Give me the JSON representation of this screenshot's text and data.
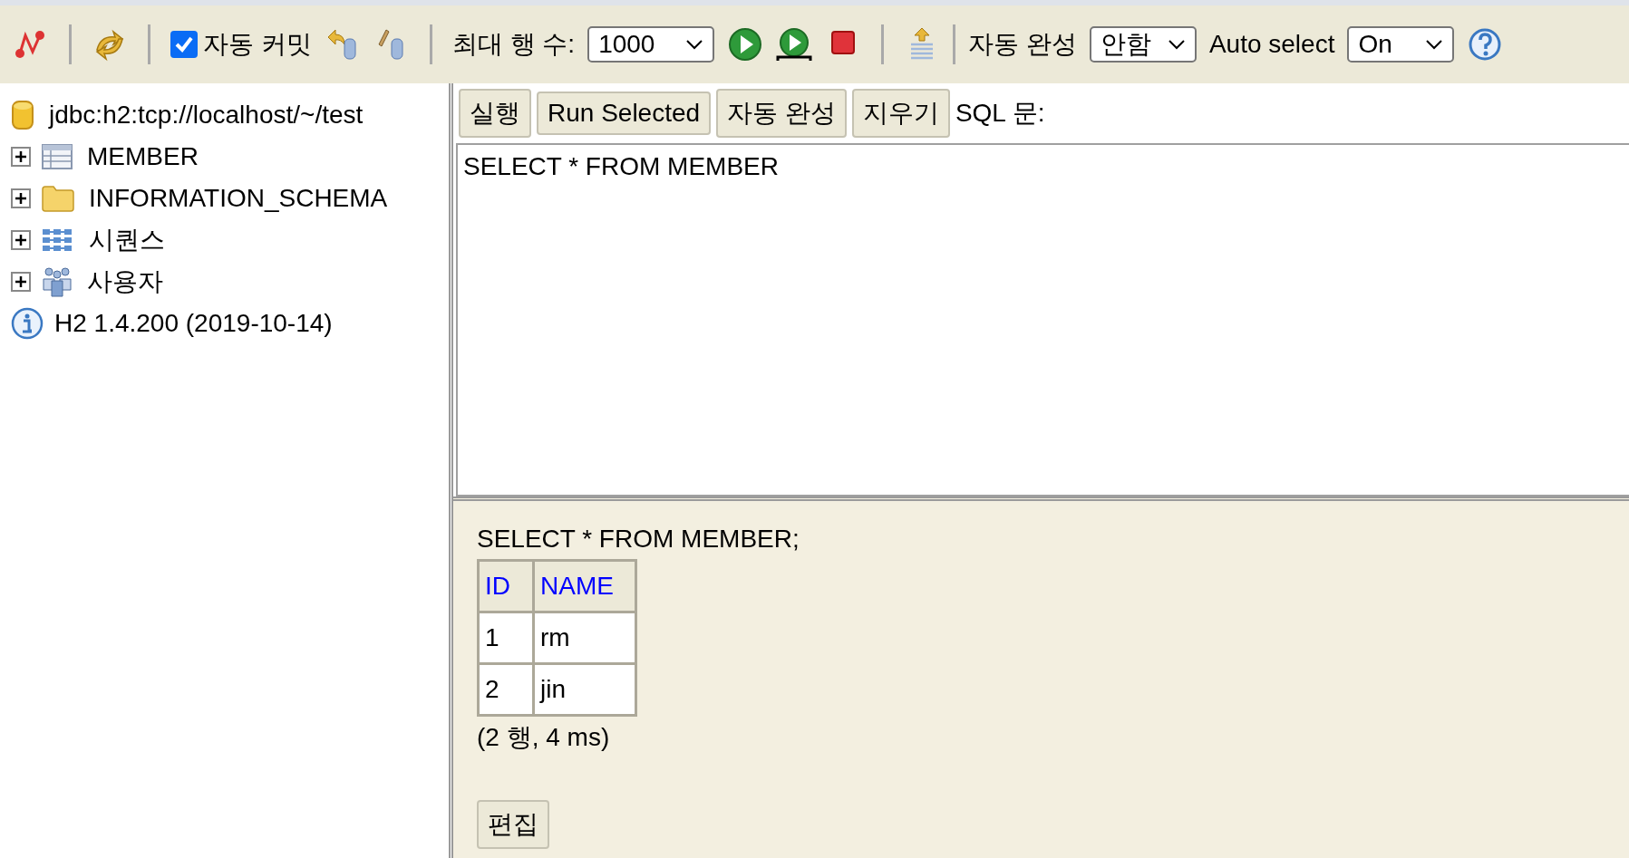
{
  "toolbar": {
    "autocommit": {
      "label": "자동 커밋",
      "checked": true
    },
    "max_rows": {
      "label": "최대 행 수:",
      "value": "1000"
    },
    "autocomplete": {
      "label": "자동 완성",
      "value": "안함"
    },
    "auto_select": {
      "label": "Auto select",
      "value": "On"
    }
  },
  "tree": {
    "connection": "jdbc:h2:tcp://localhost/~/test",
    "items": [
      {
        "label": "MEMBER",
        "kind": "table",
        "expanded": false
      },
      {
        "label": "INFORMATION_SCHEMA",
        "kind": "folder",
        "expanded": false
      },
      {
        "label": "시퀀스",
        "kind": "sequence",
        "expanded": false
      },
      {
        "label": "사용자",
        "kind": "users",
        "expanded": false
      }
    ],
    "version": "H2 1.4.200 (2019-10-14)"
  },
  "editor_buttons": [
    "실행",
    "Run Selected",
    "자동 완성",
    "지우기"
  ],
  "editor_label": "SQL 문:",
  "editor": {
    "value": "SELECT * FROM MEMBER"
  },
  "result": {
    "query": "SELECT * FROM MEMBER;",
    "columns": [
      "ID",
      "NAME"
    ],
    "rows": [
      [
        "1",
        "rm"
      ],
      [
        "2",
        "jin"
      ]
    ],
    "summary": "(2 행, 4 ms)",
    "edit_button": "편집"
  }
}
